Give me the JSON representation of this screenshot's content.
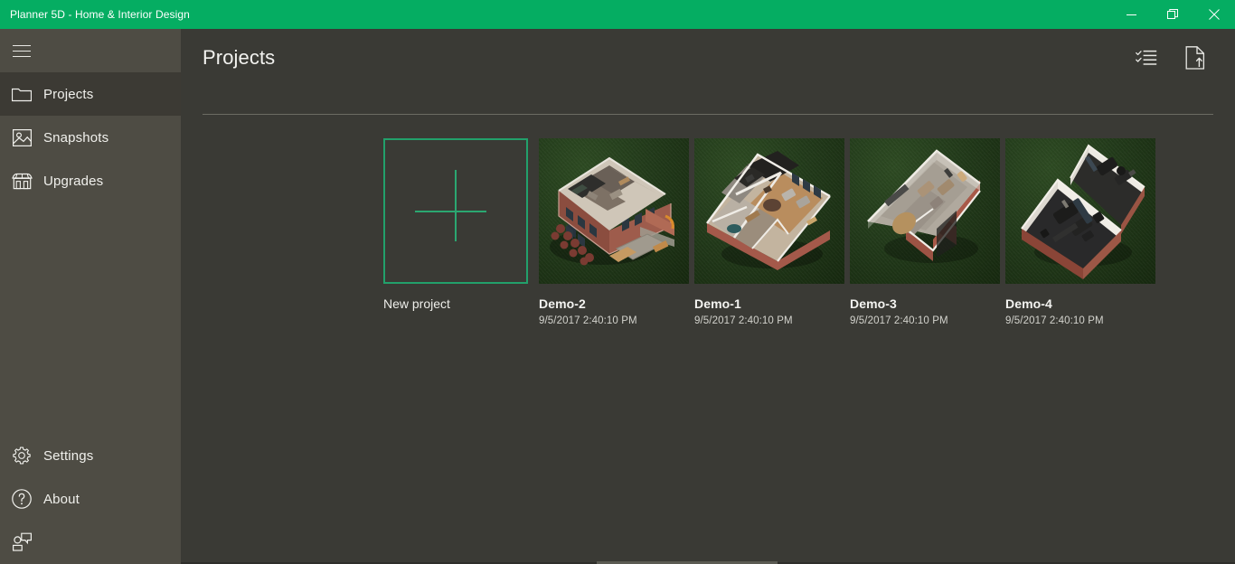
{
  "window": {
    "title": "Planner 5D - Home & Interior Design",
    "accent_color": "#05ad62",
    "controls": {
      "minimize": "minimize-icon",
      "restore": "restore-icon",
      "close": "close-icon"
    }
  },
  "sidebar": {
    "menu_button": "hamburger-icon",
    "items": [
      {
        "label": "Projects",
        "icon": "folder-icon",
        "selected": true
      },
      {
        "label": "Snapshots",
        "icon": "image-icon",
        "selected": false
      },
      {
        "label": "Upgrades",
        "icon": "store-icon",
        "selected": false
      }
    ],
    "bottom_items": [
      {
        "label": "Settings",
        "icon": "gear-icon"
      },
      {
        "label": "About",
        "icon": "question-circle-icon"
      }
    ],
    "feedback_icon": "feedback-person-icon",
    "background_color": "#4e4c44",
    "selected_background_color": "#3c3a34"
  },
  "header": {
    "title": "Projects",
    "actions": [
      {
        "name": "select-mode-button",
        "icon": "checklist-icon"
      },
      {
        "name": "import-project-button",
        "icon": "document-upload-icon"
      }
    ]
  },
  "content": {
    "new_project": {
      "caption": "New project",
      "icon": "plus-icon",
      "border_color": "#22a06b"
    },
    "projects": [
      {
        "name": "Demo-2",
        "date": "9/5/2017 2:40:10 PM"
      },
      {
        "name": "Demo-1",
        "date": "9/5/2017 2:40:10 PM"
      },
      {
        "name": "Demo-3",
        "date": "9/5/2017 2:40:10 PM"
      },
      {
        "name": "Demo-4",
        "date": "9/5/2017 2:40:10 PM"
      }
    ]
  }
}
